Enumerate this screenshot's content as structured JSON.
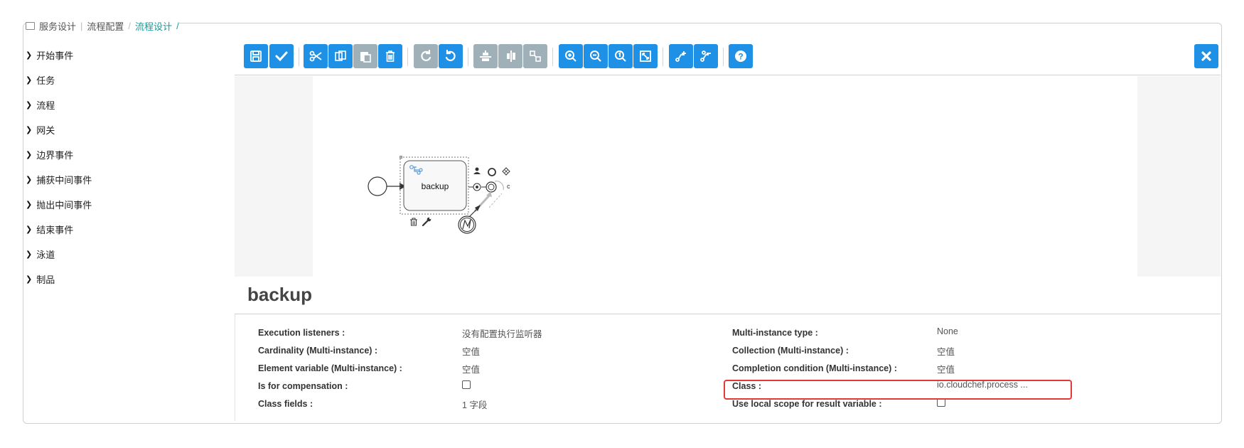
{
  "breadcrumb": {
    "items": [
      "服务设计",
      "流程配置",
      "流程设计"
    ],
    "trailing": "/"
  },
  "sidebar": {
    "items": [
      {
        "label": "开始事件"
      },
      {
        "label": "任务"
      },
      {
        "label": "流程"
      },
      {
        "label": "网关"
      },
      {
        "label": "边界事件"
      },
      {
        "label": "捕获中间事件"
      },
      {
        "label": "抛出中间事件"
      },
      {
        "label": "结束事件"
      },
      {
        "label": "泳道"
      },
      {
        "label": "制品"
      }
    ]
  },
  "toolbar": {
    "buttons": [
      {
        "icon": "save-icon",
        "state": "enabled"
      },
      {
        "icon": "validate-icon",
        "state": "enabled"
      },
      {
        "icon": "cut-icon",
        "state": "enabled"
      },
      {
        "icon": "copy-icon",
        "state": "enabled"
      },
      {
        "icon": "paste-icon",
        "state": "disabled"
      },
      {
        "icon": "delete-icon",
        "state": "enabled"
      },
      {
        "icon": "redo-icon",
        "state": "disabled"
      },
      {
        "icon": "undo-icon",
        "state": "enabled"
      },
      {
        "icon": "align-horizontal-icon",
        "state": "disabled"
      },
      {
        "icon": "align-vertical-icon",
        "state": "disabled"
      },
      {
        "icon": "same-size-icon",
        "state": "disabled"
      },
      {
        "icon": "zoom-in-icon",
        "state": "enabled"
      },
      {
        "icon": "zoom-out-icon",
        "state": "enabled"
      },
      {
        "icon": "zoom-actual-icon",
        "state": "enabled"
      },
      {
        "icon": "zoom-fit-icon",
        "state": "enabled"
      },
      {
        "icon": "add-bendpoint-icon",
        "state": "enabled"
      },
      {
        "icon": "remove-bendpoint-icon",
        "state": "enabled"
      },
      {
        "icon": "help-icon",
        "state": "enabled"
      }
    ],
    "close_icon": "close-icon",
    "colors": {
      "enabled": "#1e90e6",
      "disabled": "#9fb0b8"
    }
  },
  "diagram": {
    "task_label": "backup",
    "extra_marker": "c"
  },
  "properties": {
    "title": "backup",
    "left": [
      {
        "label": "Execution listeners :",
        "value": "没有配置执行监听器"
      },
      {
        "label": "Cardinality (Multi-instance) :",
        "value": "空值"
      },
      {
        "label": "Element variable (Multi-instance) :",
        "value": "空值"
      },
      {
        "label": "Is for compensation :",
        "value": ""
      },
      {
        "label": "Class fields :",
        "value": "1 字段"
      }
    ],
    "right": [
      {
        "label": "Multi-instance type :",
        "value": "None"
      },
      {
        "label": "Collection (Multi-instance) :",
        "value": "空值"
      },
      {
        "label": "Completion condition (Multi-instance) :",
        "value": "空值"
      },
      {
        "label": "Class :",
        "value": "io.cloudchef.process ..."
      },
      {
        "label": "Use local scope for result variable :",
        "value": ""
      }
    ],
    "highlight_color": "#e53935"
  }
}
